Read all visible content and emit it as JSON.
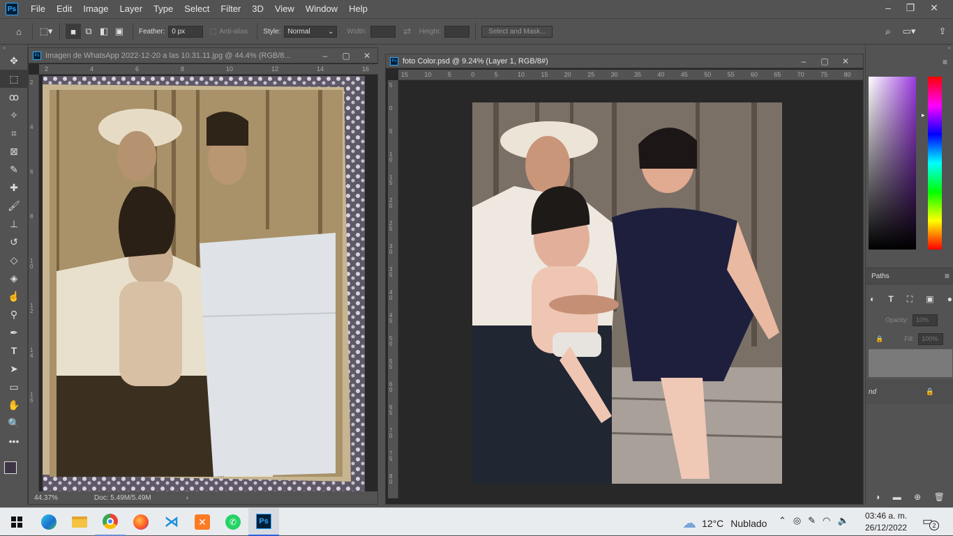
{
  "app": {
    "logo": "Ps"
  },
  "menu": [
    "File",
    "Edit",
    "Image",
    "Layer",
    "Type",
    "Select",
    "Filter",
    "3D",
    "View",
    "Window",
    "Help"
  ],
  "options": {
    "feather_label": "Feather:",
    "feather_value": "0 px",
    "antialias_label": "Anti-alias",
    "style_label": "Style:",
    "style_value": "Normal",
    "width_label": "Width:",
    "height_label": "Height:",
    "select_mask_label": "Select and Mask..."
  },
  "doc1": {
    "title": "Imagen de WhatsApp 2022-12-20 a las 10.31.11.jpg @ 44.4% (RGB/8...",
    "zoom": "44.37%",
    "docsize": "Doc: 5.49M/5.49M",
    "ruler_h": [
      "2",
      "4",
      "6",
      "8",
      "10",
      "12",
      "14",
      "16"
    ],
    "ruler_v": [
      "2",
      "4",
      "6",
      "8",
      "1\n0",
      "1\n2",
      "1\n4",
      "1\n6"
    ]
  },
  "doc2": {
    "title": "foto Color.psd @ 9.24% (Layer 1, RGB/8#)",
    "ruler_h": [
      "15",
      "10",
      "5",
      "0",
      "5",
      "10",
      "15",
      "20",
      "25",
      "30",
      "35",
      "40",
      "45",
      "50",
      "55",
      "60",
      "65",
      "70",
      "75",
      "80"
    ],
    "ruler_v": [
      "5",
      "0",
      "5",
      "1\n0",
      "1\n5",
      "2\n0",
      "2\n5",
      "3\n0",
      "3\n5",
      "4\n0",
      "4\n5",
      "5\n0",
      "5\n5",
      "6\n0",
      "6\n5",
      "7\n0",
      "7\n5",
      "8\n0"
    ]
  },
  "panels": {
    "paths_label": "Paths",
    "opacity_label": "Opacity:",
    "opacity_value": "10%",
    "fill_label": "Fill:",
    "fill_value": "100%",
    "layer_name": "nd"
  },
  "taskbar": {
    "weather_temp": "12°C",
    "weather_desc": "Nublado",
    "time": "03:46 a. m.",
    "date": "26/12/2022",
    "notif_count": "2"
  },
  "colors": {
    "ui_bg": "#535353",
    "canvas_bg": "#282828",
    "ps_blue": "#31a8ff"
  }
}
